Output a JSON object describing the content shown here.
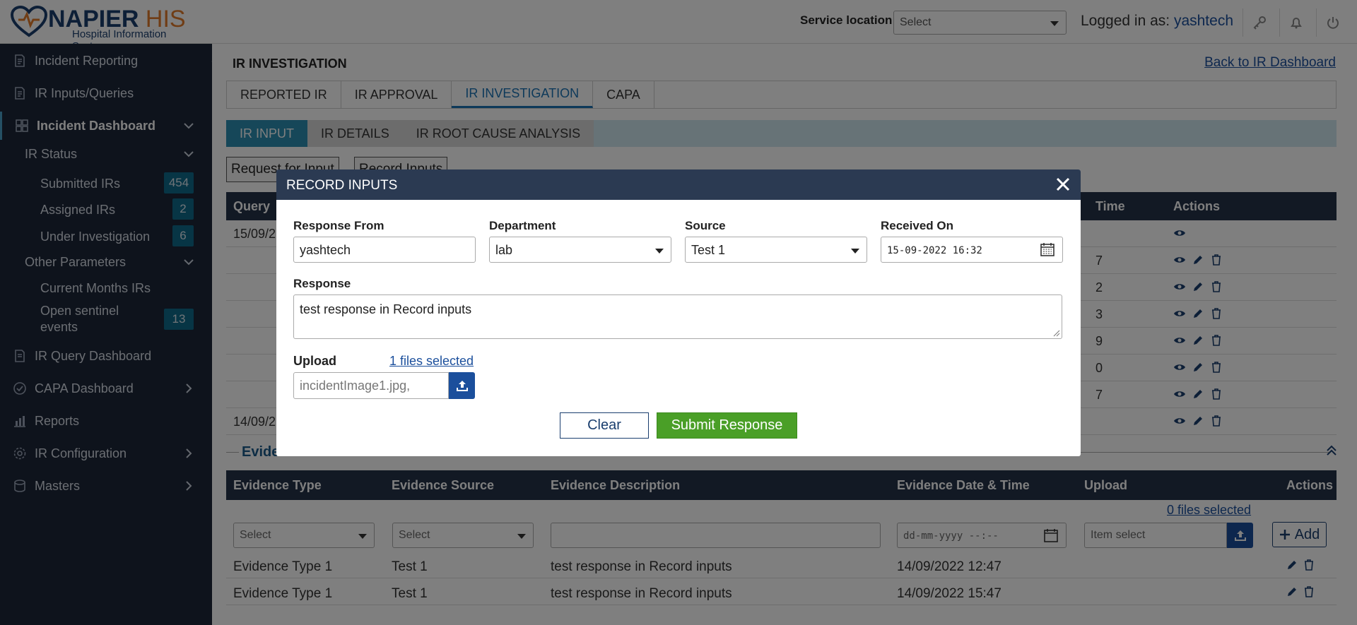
{
  "header": {
    "logo_title": "NAPIER",
    "logo_his": "HIS",
    "logo_sub": "Hospital Information System",
    "service_location_label": "Service location",
    "service_location_value": "Select",
    "logged_in_label": "Logged in as:",
    "logged_in_user": "yashtech"
  },
  "sidebar": {
    "items": [
      {
        "label": "Incident Reporting"
      },
      {
        "label": "IR Inputs/Queries"
      },
      {
        "label": "Incident Dashboard"
      },
      {
        "label": "IR Query Dashboard"
      },
      {
        "label": "CAPA Dashboard"
      },
      {
        "label": "Reports"
      },
      {
        "label": "IR Configuration"
      },
      {
        "label": "Masters"
      }
    ],
    "ir_status_label": "IR Status",
    "submitted_label": "Submitted IRs",
    "submitted_count": "454",
    "assigned_label": "Assigned IRs",
    "assigned_count": "2",
    "under_inv_label": "Under Investigation",
    "under_inv_count": "6",
    "other_params_label": "Other Parameters",
    "current_months_label": "Current Months IRs",
    "open_sentinel_label1": "Open sentinel",
    "open_sentinel_label2": "events",
    "open_sentinel_count": "13"
  },
  "main": {
    "page_title": "IR INVESTIGATION",
    "back_link": "Back to IR Dashboard",
    "tabs": [
      "REPORTED IR",
      "IR APPROVAL",
      "IR INVESTIGATION",
      "CAPA"
    ],
    "subtabs": [
      "IR INPUT",
      "IR DETAILS",
      "IR ROOT CAUSE ANALYSIS"
    ],
    "btn_request": "Request for Input",
    "btn_record": "Record Inputs",
    "query_head_col1": "Query",
    "query_head_time": "Time",
    "query_head_actions": "Actions",
    "query_first_date": "15/09/2",
    "query_last_date": "14/09/2",
    "query_time_digits": [
      "7",
      "2",
      "3",
      "9",
      "0",
      "7"
    ],
    "evidence_title": "Evidence",
    "evidence_headers": [
      "Evidence Type",
      "Evidence Source",
      "Evidence Description",
      "Evidence Date & Time",
      "Upload",
      "Actions"
    ],
    "evidence_files_selected": "0 files selected",
    "evidence_type_placeholder": "Select",
    "evidence_source_placeholder": "Select",
    "evidence_date_placeholder": "dd-mm-yyyy --:--",
    "evidence_upload_placeholder": "Item select",
    "evidence_add": "Add",
    "evidence_rows": [
      {
        "type": "Evidence Type 1",
        "source": "Test 1",
        "desc": "test response in Record inputs",
        "date": "14/09/2022 12:47"
      },
      {
        "type": "Evidence Type 1",
        "source": "Test 1",
        "desc": "test response in Record inputs",
        "date": "14/09/2022 15:47"
      }
    ]
  },
  "modal": {
    "title": "RECORD INPUTS",
    "response_from_label": "Response From",
    "response_from_value": "yashtech",
    "department_label": "Department",
    "department_value": "lab",
    "source_label": "Source",
    "source_value": "Test 1",
    "received_on_label": "Received On",
    "received_on_value": "15-09-2022 16:32",
    "response_label": "Response",
    "response_value": "test response in Record inputs",
    "upload_label": "Upload",
    "files_selected": "1 files selected",
    "upload_value": "incidentImage1.jpg,",
    "clear_label": "Clear",
    "submit_label": "Submit Response"
  },
  "colors": {
    "sidebar_bg": "#1d2738",
    "table_head": "#243249",
    "modal_head": "#2b3a52",
    "submit_green": "#4a9f27",
    "link_blue": "#1b4f9c",
    "accent_teal": "#2c8fb3"
  },
  "icons": [
    "heart-logo-icon",
    "key-icon",
    "bell-icon",
    "power-icon",
    "chevron-left-icon",
    "chevron-down-icon",
    "chevron-right-icon",
    "eye-icon",
    "pencil-icon",
    "trash-icon",
    "calendar-icon",
    "upload-icon",
    "close-icon",
    "plus-icon",
    "collapse-up-icon"
  ]
}
